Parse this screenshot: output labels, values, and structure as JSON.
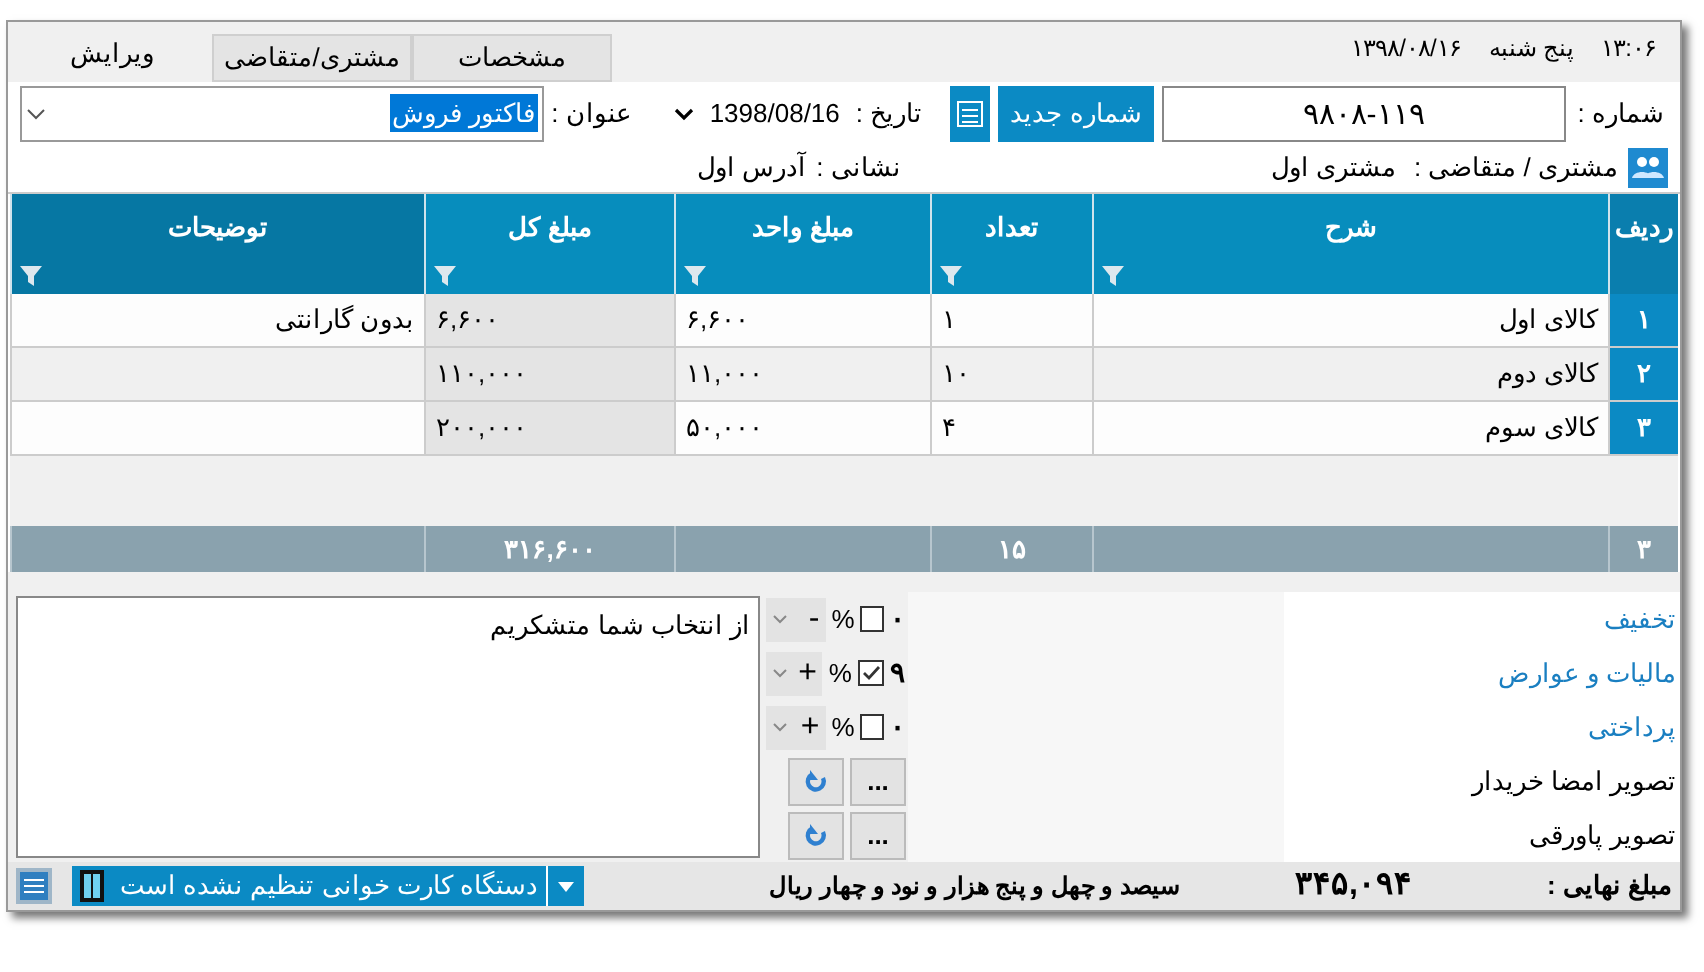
{
  "header": {
    "time": "۱۳:۰۶",
    "weekday": "پنج شنبه",
    "date": "۱۳۹۸/۰۸/۱۶"
  },
  "tabs": [
    {
      "label": "مشخصات",
      "selected": false
    },
    {
      "label": "مشتری/متقاضی",
      "selected": false
    },
    {
      "label": "ویرایش",
      "selected": true
    }
  ],
  "number": {
    "label": "شماره :",
    "value": "۹۸۰۸-۱۱۹",
    "button": "شماره جدید"
  },
  "date_field": {
    "label": "تاریخ :",
    "value": "1398/08/16"
  },
  "title_field": {
    "label": "عنوان :",
    "value": "فاکتور فروش"
  },
  "customer": {
    "label": "مشتری / متقاضی :",
    "value": "مشتری اول"
  },
  "address": {
    "label": "نشانی :",
    "value": "آدرس اول"
  },
  "table": {
    "columns": [
      "ردیف",
      "شرح",
      "تعداد",
      "مبلغ واحد",
      "مبلغ کل",
      "توضیحات"
    ],
    "rows": [
      {
        "cells": [
          "۱",
          "کالای اول",
          "۱",
          "۶,۶۰۰",
          "۶,۶۰۰",
          "بدون گارانتی"
        ]
      },
      {
        "cells": [
          "۲",
          "کالای دوم",
          "۱۰",
          "۱۱,۰۰۰",
          "۱۱۰,۰۰۰"
        ]
      },
      {
        "cells": [
          "۳",
          "کالای سوم",
          "۴",
          "۵۰,۰۰۰",
          "۲۰۰,۰۰۰"
        ]
      }
    ],
    "footer": {
      "row_count": "۳",
      "quantity_total": "۱۵",
      "amount_total": "۳۱۶,۶۰۰"
    }
  },
  "notes": "از انتخاب شما متشکریم",
  "adjustments": [
    {
      "kind": "amount",
      "label": "تخفیف",
      "sign": "-",
      "percent": "%",
      "percent_checked": false,
      "value": "۰"
    },
    {
      "kind": "amount",
      "label": "مالیات و عوارض",
      "sign": "+",
      "percent": "%",
      "percent_checked": true,
      "value": "۹"
    },
    {
      "kind": "amount",
      "label": "پرداختی",
      "sign": "+",
      "percent": "%",
      "percent_checked": false,
      "value": "۰"
    },
    {
      "kind": "image",
      "label": "تصویر امضا خریدار",
      "browse": "..."
    },
    {
      "kind": "image",
      "label": "تصویر پاورقی",
      "browse": "..."
    }
  ],
  "total": {
    "label": "مبلغ نهایی :",
    "amount": "۳۴۵,۰۹۴",
    "words": "سیصد و چهل و پنج هزار و نود و چهار ریال"
  },
  "card_reader": "دستگاه کارت خوانی تنظیم نشده است"
}
